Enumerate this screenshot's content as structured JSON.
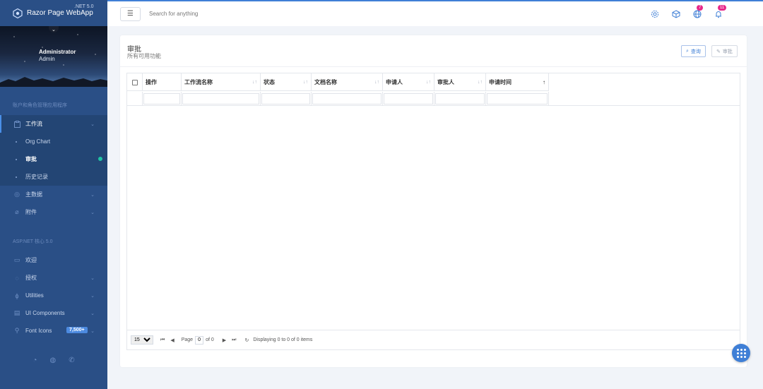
{
  "brand": {
    "name": "Razor Page WebApp",
    "version": ".NET 5.0"
  },
  "profile": {
    "name": "Administrator",
    "role": "Admin"
  },
  "sidebar": {
    "section1": "账户和角色管理应用程序",
    "workflow": {
      "label": "工作流",
      "children": [
        "Org Chart",
        "审批",
        "历史记录"
      ]
    },
    "masterdata": "主数据",
    "attachments": "附件",
    "section2": "ASP.NET 核心 5.0",
    "welcome": "欢迎",
    "auth": "授权",
    "utilities": "Utilities",
    "ui_components": "UI Components",
    "font_icons": "Font Icons",
    "font_icons_badge": "7,500+"
  },
  "topbar": {
    "search_placeholder": "Search for anything",
    "globe_count": "7",
    "bell_count": "11"
  },
  "card": {
    "title": "审批",
    "subtitle": "所有可用功能",
    "query_btn": "查询",
    "approve_btn": "审批"
  },
  "grid": {
    "columns": [
      "操作",
      "工作流名称",
      "状态",
      "文档名称",
      "申请人",
      "审批人",
      "申请时间"
    ]
  },
  "pager": {
    "page_size": "15",
    "page_label": "Page",
    "page_value": "0",
    "of_label": "of 0",
    "display_text": "Displaying 0 to 0 of 0 items"
  },
  "colors": {
    "sidebar": "#2a4f86",
    "accent": "#3f7fd6",
    "badge": "#e7288a",
    "active_dot": "#1fc4a3"
  }
}
